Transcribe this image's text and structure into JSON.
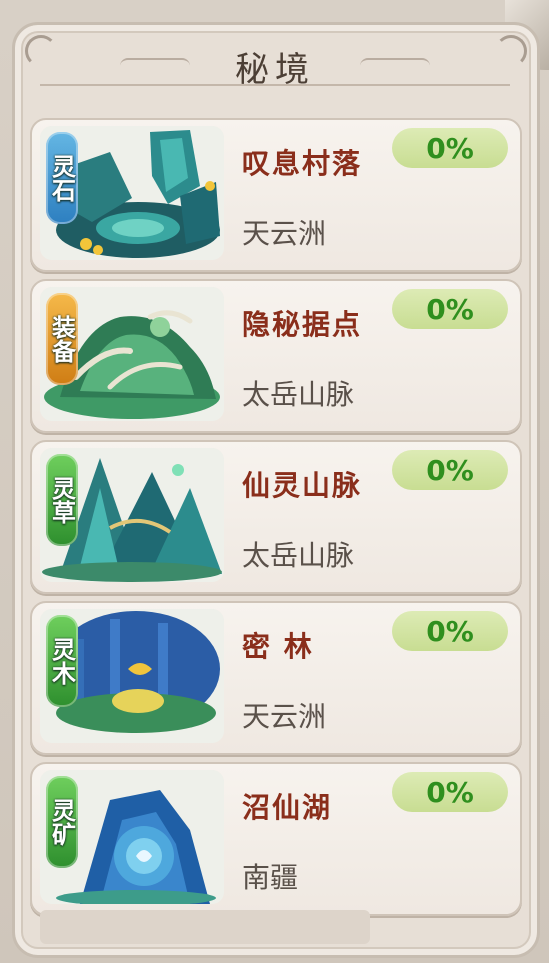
{
  "header": {
    "title": "秘境"
  },
  "realms": [
    {
      "tag": "灵石",
      "tag_color": "#2d7fc0",
      "name": "叹息村落",
      "region": "天云洲",
      "progress": "0%"
    },
    {
      "tag": "装备",
      "tag_color": "#cf7d14",
      "name": "隐秘据点",
      "region": "太岳山脉",
      "progress": "0%"
    },
    {
      "tag": "灵草",
      "tag_color": "#2e8f2e",
      "name": "仙灵山脉",
      "region": "太岳山脉",
      "progress": "0%"
    },
    {
      "tag": "灵木",
      "tag_color": "#2e8f2e",
      "name": "密  林",
      "region": "天云洲",
      "progress": "0%"
    },
    {
      "tag": "灵矿",
      "tag_color": "#2e8f2e",
      "name": "沼仙湖",
      "region": "南疆",
      "progress": "0%"
    }
  ]
}
